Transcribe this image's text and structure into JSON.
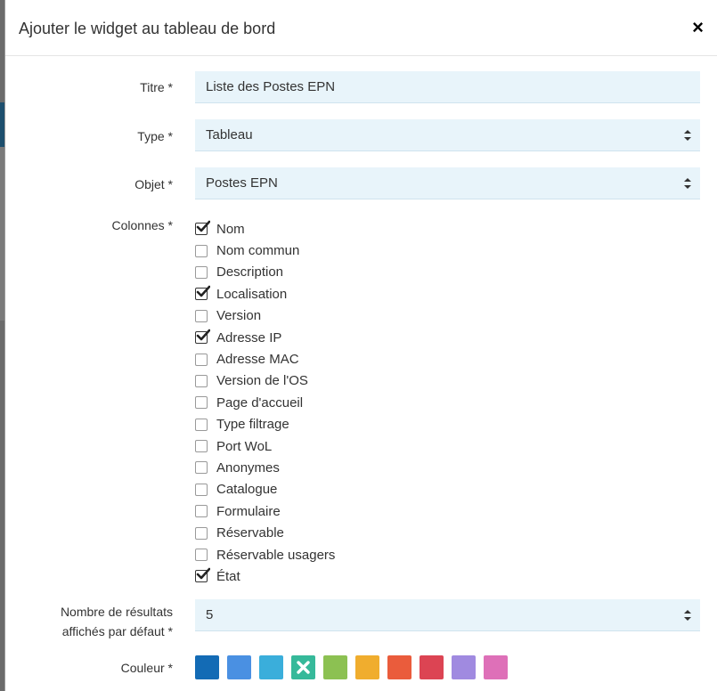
{
  "modal": {
    "title": "Ajouter le widget au tableau de bord",
    "close_label": "×"
  },
  "form": {
    "titre": {
      "label": "Titre *",
      "value": "Liste des Postes EPN"
    },
    "type": {
      "label": "Type *",
      "value": "Tableau"
    },
    "objet": {
      "label": "Objet *",
      "value": "Postes EPN"
    },
    "colonnes": {
      "label": "Colonnes *",
      "items": [
        {
          "label": "Nom",
          "checked": true
        },
        {
          "label": "Nom commun",
          "checked": false
        },
        {
          "label": "Description",
          "checked": false
        },
        {
          "label": "Localisation",
          "checked": true
        },
        {
          "label": "Version",
          "checked": false
        },
        {
          "label": "Adresse IP",
          "checked": true
        },
        {
          "label": "Adresse MAC",
          "checked": false
        },
        {
          "label": "Version de l'OS",
          "checked": false
        },
        {
          "label": "Page d'accueil",
          "checked": false
        },
        {
          "label": "Type filtrage",
          "checked": false
        },
        {
          "label": "Port WoL",
          "checked": false
        },
        {
          "label": "Anonymes",
          "checked": false
        },
        {
          "label": "Catalogue",
          "checked": false
        },
        {
          "label": "Formulaire",
          "checked": false
        },
        {
          "label": "Réservable",
          "checked": false
        },
        {
          "label": "Réservable usagers",
          "checked": false
        },
        {
          "label": "État",
          "checked": true
        }
      ]
    },
    "nombre": {
      "label_line1": "Nombre de résultats",
      "label_line2": "affichés par défaut *",
      "value": "5"
    },
    "couleur": {
      "label": "Couleur *",
      "swatches": [
        {
          "color": "#136bb5",
          "selected": false
        },
        {
          "color": "#4a90e2",
          "selected": false
        },
        {
          "color": "#3aaedb",
          "selected": false
        },
        {
          "color": "#36b99a",
          "selected": true
        },
        {
          "color": "#8cc152",
          "selected": false
        },
        {
          "color": "#f0ad2e",
          "selected": false
        },
        {
          "color": "#ea5c3c",
          "selected": false
        },
        {
          "color": "#dc4453",
          "selected": false
        },
        {
          "color": "#a08ae0",
          "selected": false
        },
        {
          "color": "#de70b8",
          "selected": false
        }
      ]
    }
  }
}
